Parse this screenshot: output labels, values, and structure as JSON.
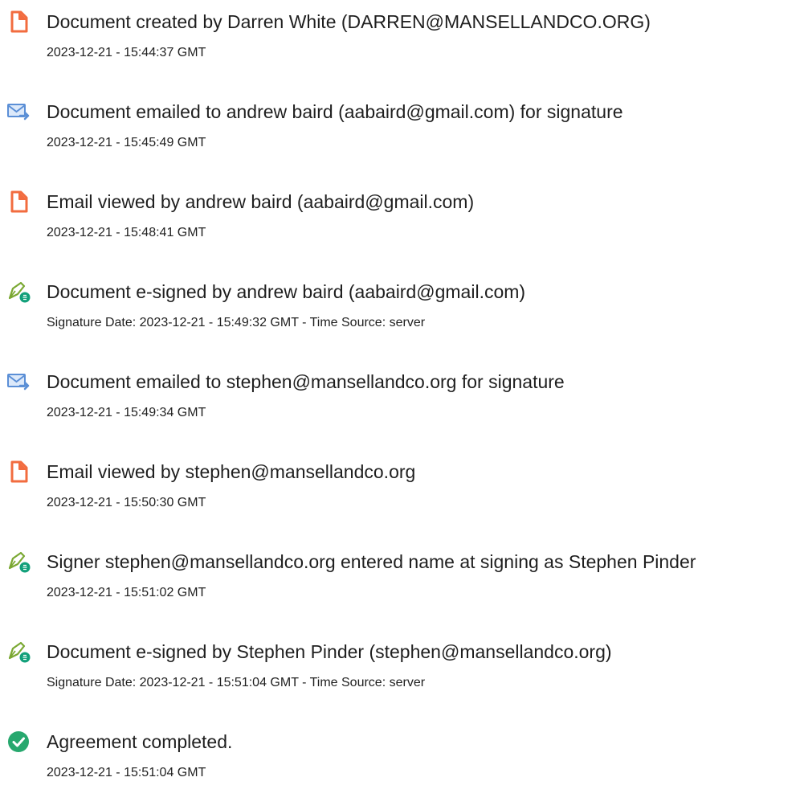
{
  "events": [
    {
      "icon": "document-icon",
      "title": "Document created by Darren White (DARREN@MANSELLANDCO.ORG)",
      "detail": "2023-12-21 - 15:44:37 GMT"
    },
    {
      "icon": "email-send-icon",
      "title": "Document emailed to andrew baird (aabaird@gmail.com) for signature",
      "detail": "2023-12-21 - 15:45:49 GMT"
    },
    {
      "icon": "document-icon",
      "title": "Email viewed by andrew baird (aabaird@gmail.com)",
      "detail": "2023-12-21 - 15:48:41 GMT"
    },
    {
      "icon": "pen-sign-icon",
      "title": "Document e-signed by andrew baird (aabaird@gmail.com)",
      "detail": "Signature Date: 2023-12-21 - 15:49:32 GMT - Time Source: server"
    },
    {
      "icon": "email-send-icon",
      "title": "Document emailed to stephen@mansellandco.org for signature",
      "detail": "2023-12-21 - 15:49:34 GMT"
    },
    {
      "icon": "document-icon",
      "title": "Email viewed by stephen@mansellandco.org",
      "detail": "2023-12-21 - 15:50:30 GMT"
    },
    {
      "icon": "pen-sign-icon",
      "title": "Signer stephen@mansellandco.org entered name at signing as Stephen Pinder",
      "detail": "2023-12-21 - 15:51:02 GMT"
    },
    {
      "icon": "pen-sign-icon",
      "title": "Document e-signed by Stephen Pinder (stephen@mansellandco.org)",
      "detail": "Signature Date: 2023-12-21 - 15:51:04 GMT - Time Source: server"
    },
    {
      "icon": "check-circle-icon",
      "title": "Agreement completed.",
      "detail": "2023-12-21 - 15:51:04 GMT"
    }
  ],
  "colors": {
    "document_icon": "#f26c3f",
    "email_icon": "#5b8fd6",
    "pen_icon": "#7aa832",
    "pen_badge": "#12a07a",
    "check_icon": "#27a86e",
    "text": "#1f1f1f"
  }
}
